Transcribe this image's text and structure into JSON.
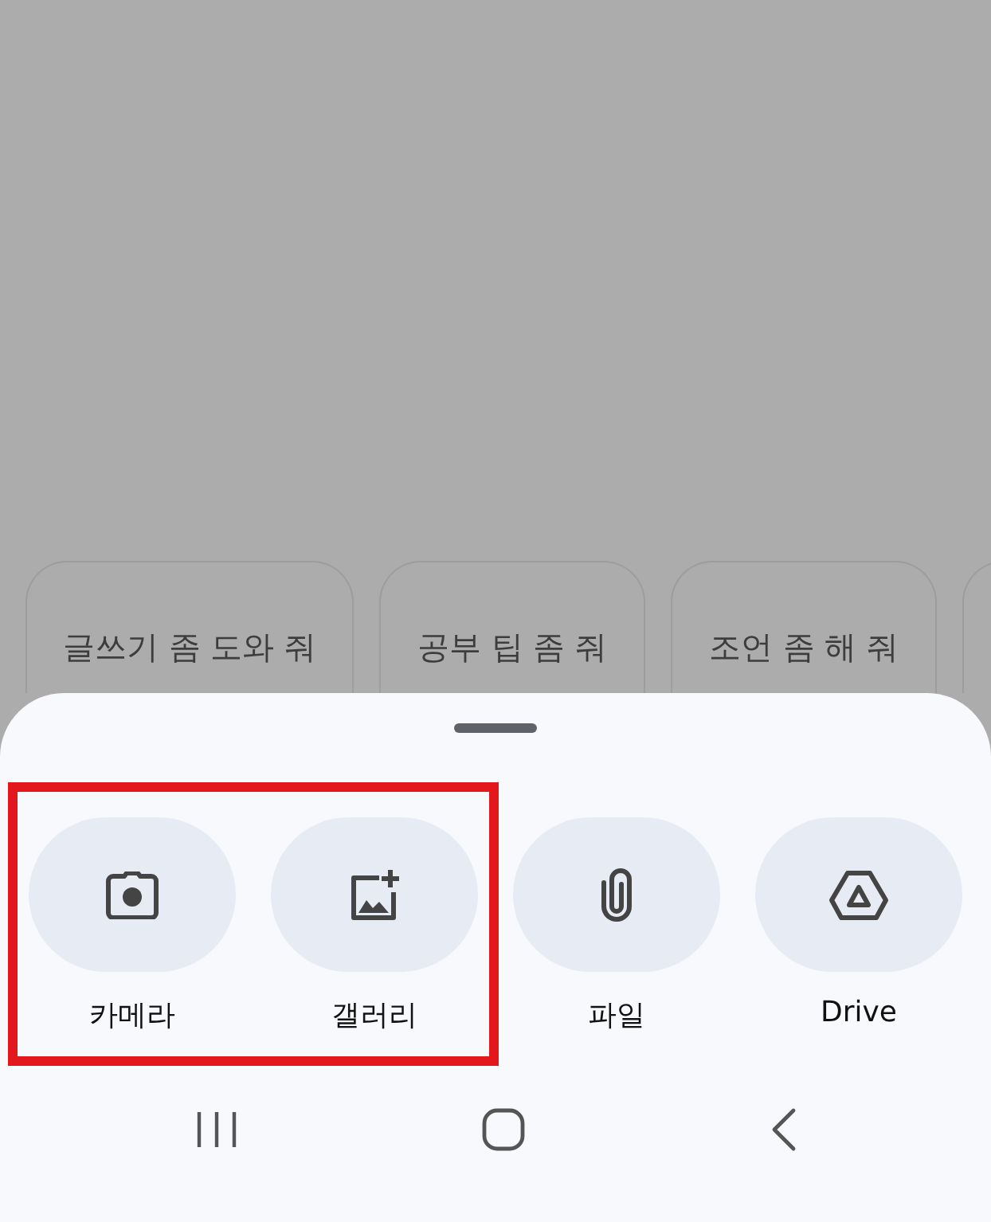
{
  "suggestions": [
    {
      "label": "글쓰기 좀 도와 줘"
    },
    {
      "label": "공부 팁 좀 줘"
    },
    {
      "label": "조언 좀 해 줘"
    }
  ],
  "attach_options": [
    {
      "kind": "camera",
      "label": "카메라",
      "highlighted": true
    },
    {
      "kind": "gallery",
      "label": "갤러리",
      "highlighted": true
    },
    {
      "kind": "file",
      "label": "파일",
      "highlighted": false
    },
    {
      "kind": "drive",
      "label": "Drive",
      "highlighted": false
    }
  ],
  "nav_bar": [
    {
      "kind": "recents"
    },
    {
      "kind": "home"
    },
    {
      "kind": "back"
    }
  ]
}
